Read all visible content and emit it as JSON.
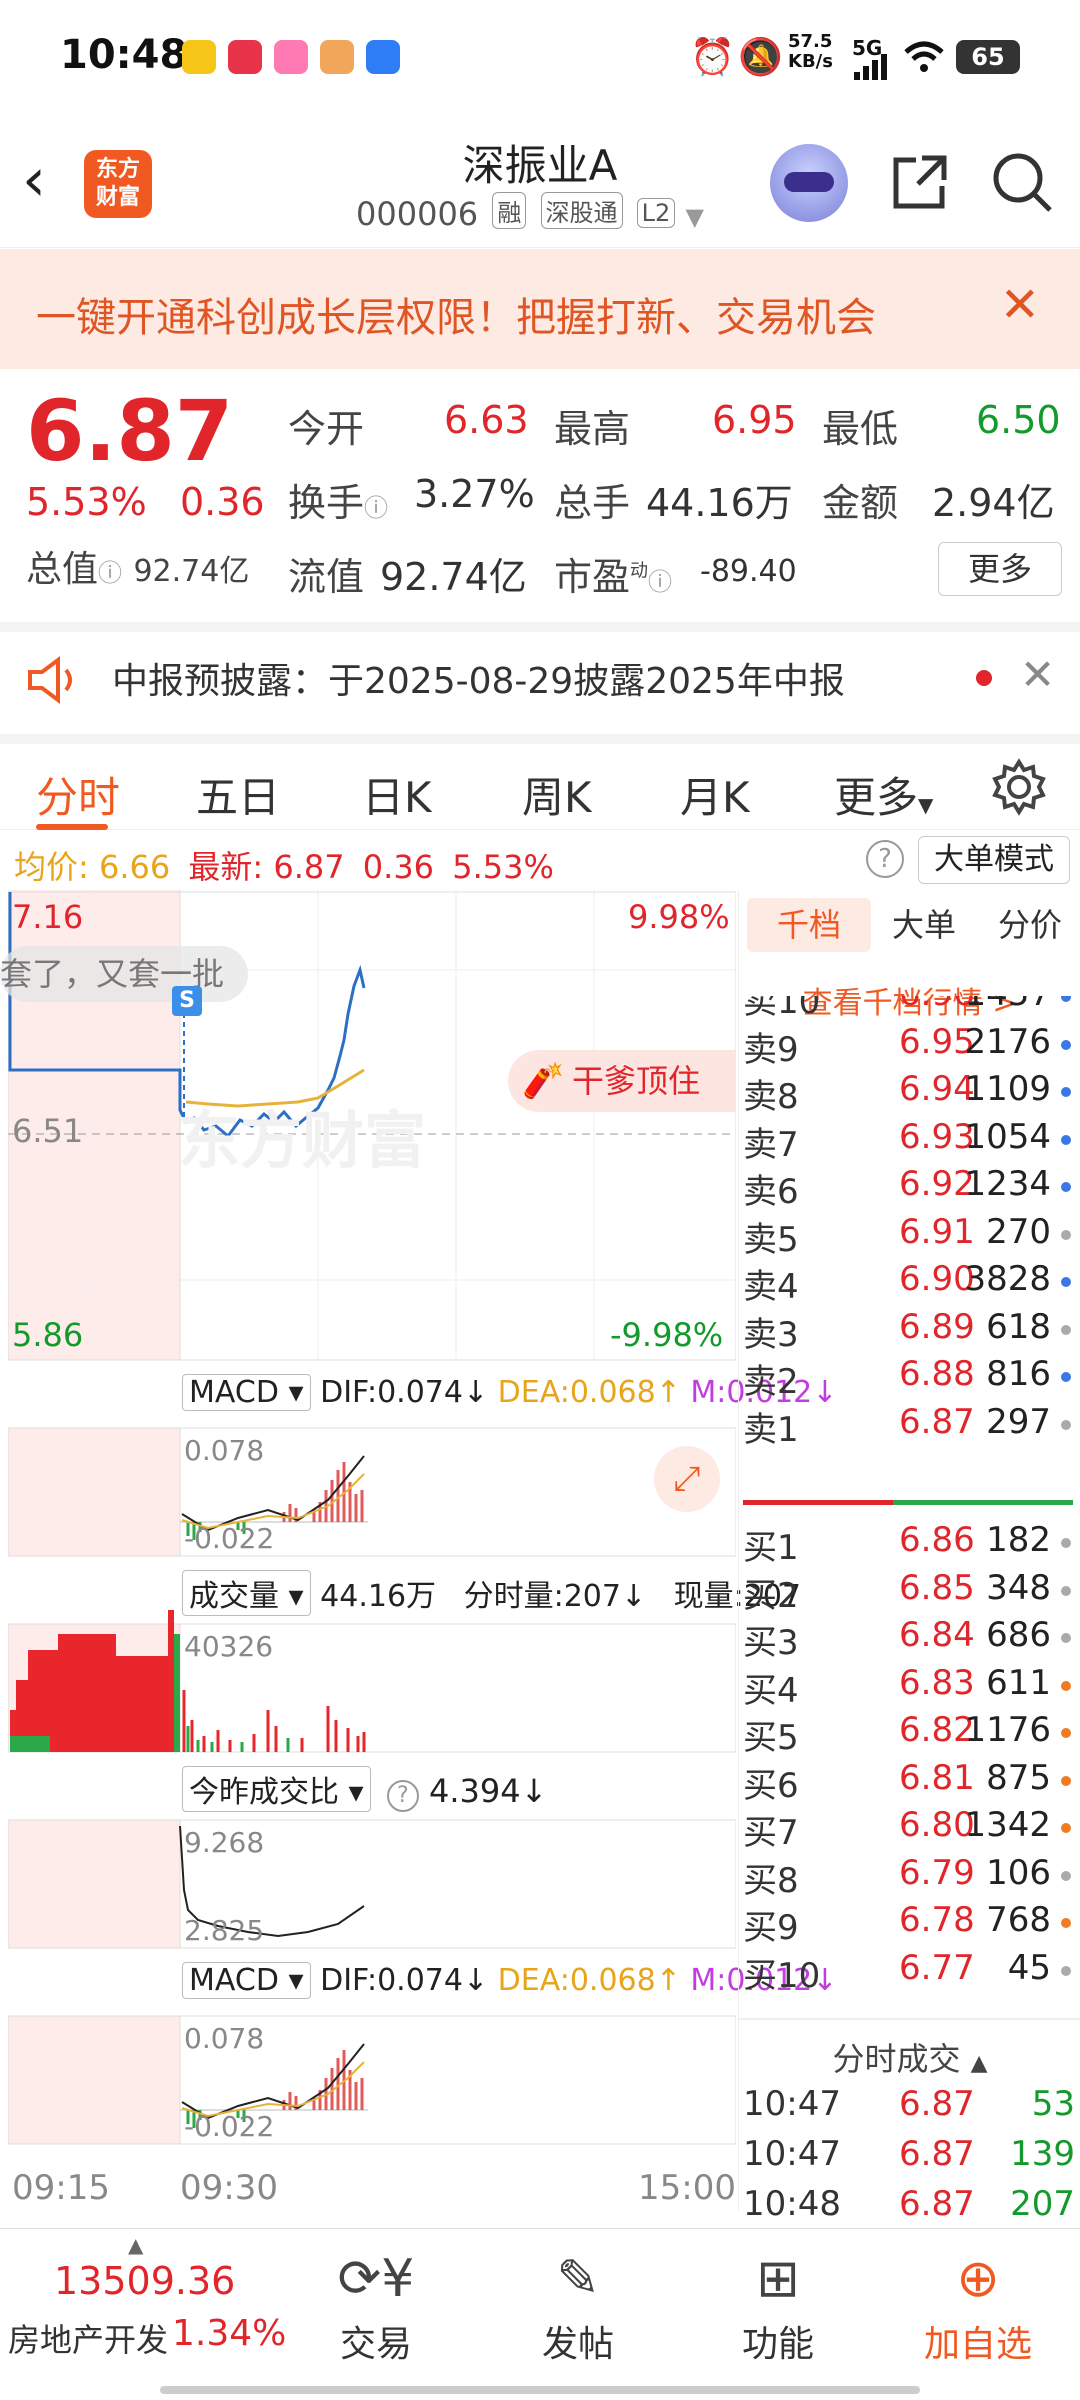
{
  "status": {
    "time": "10:48",
    "net_speed": "57.5",
    "net_unit": "KB/s",
    "network": "5G",
    "battery": "65"
  },
  "header": {
    "title": "深振业A",
    "code": "000006",
    "tags": [
      "融",
      "深股通",
      "L2"
    ]
  },
  "banner": {
    "text": "一键开通科创成长层权限！把握打新、交易机会",
    "close": "✕"
  },
  "quote": {
    "price": "6.87",
    "change_pct": "5.53%",
    "change": "0.36",
    "total_value_label": "总值",
    "total_value": "92.74亿",
    "open_label": "今开",
    "open": "6.63",
    "high_label": "最高",
    "high": "6.95",
    "low_label": "最低",
    "low": "6.50",
    "turnover_label": "换手",
    "turnover": "3.27%",
    "volume_label": "总手",
    "volume": "44.16万",
    "amount_label": "金额",
    "amount": "2.94亿",
    "float_label": "流值",
    "float_value": "92.74亿",
    "pe_label": "市盈",
    "pe_sup": "动",
    "pe": "-89.40",
    "more": "更多"
  },
  "notice": {
    "text": "中报预披露：于2025-08-29披露2025年中报"
  },
  "tabs": [
    "分时",
    "五日",
    "日K",
    "周K",
    "月K",
    "更多"
  ],
  "infoline": {
    "avg_label": "均价:",
    "avg": "6.66",
    "latest_label": "最新:",
    "latest": "6.87",
    "chg": "0.36",
    "pct": "5.53%",
    "big_order_mode": "大单模式"
  },
  "chart": {
    "y_top": "7.16",
    "y_mid": "6.51",
    "y_bottom": "5.86",
    "pct_top": "9.98%",
    "pct_bottom": "-9.98%",
    "danmu": "套了，又套一批",
    "s_marker": "S",
    "promo": "干爹顶住",
    "watermark": "东方财富",
    "macd1": {
      "name": "MACD",
      "dif": "DIF:0.074↓",
      "dea": "DEA:0.068↑",
      "m": "M:0.012↓",
      "top": "0.078",
      "bottom": "-0.022"
    },
    "vol": {
      "name": "成交量",
      "total": "44.16万",
      "tick_label": "分时量:207↓",
      "now": "现量:207",
      "top": "40326"
    },
    "ratio": {
      "name": "今昨成交比",
      "value": "4.394↓",
      "top": "9.268",
      "bottom": "2.825"
    },
    "macd2": {
      "name": "MACD",
      "dif": "DIF:0.074↓",
      "dea": "DEA:0.068↑",
      "m": "M:0.012↓",
      "top": "0.078",
      "bottom": "-0.022"
    },
    "x_labels": [
      "09:15",
      "09:30",
      "15:00"
    ]
  },
  "book": {
    "tabs": [
      "千档",
      "大单",
      "分价"
    ],
    "link": "查看千档行情 >",
    "sells": [
      {
        "name": "卖10",
        "price": "6.96",
        "vol": "1457",
        "dot": "#3b78e7"
      },
      {
        "name": "卖9",
        "price": "6.95",
        "vol": "2176",
        "dot": "#3b78e7"
      },
      {
        "name": "卖8",
        "price": "6.94",
        "vol": "1109",
        "dot": "#3b78e7"
      },
      {
        "name": "卖7",
        "price": "6.93",
        "vol": "1054",
        "dot": "#3b78e7"
      },
      {
        "name": "卖6",
        "price": "6.92",
        "vol": "1234",
        "dot": "#3b78e7"
      },
      {
        "name": "卖5",
        "price": "6.91",
        "vol": "270",
        "dot": "#aaaaaa"
      },
      {
        "name": "卖4",
        "price": "6.90",
        "vol": "3828",
        "dot": "#3b78e7"
      },
      {
        "name": "卖3",
        "price": "6.89",
        "vol": "618",
        "dot": "#aaaaaa"
      },
      {
        "name": "卖2",
        "price": "6.88",
        "vol": "816",
        "dot": "#3b78e7"
      },
      {
        "name": "卖1",
        "price": "6.87",
        "vol": "297",
        "dot": "#aaaaaa"
      }
    ],
    "buys": [
      {
        "name": "买1",
        "price": "6.86",
        "vol": "182",
        "dot": "#aaaaaa"
      },
      {
        "name": "买2",
        "price": "6.85",
        "vol": "348",
        "dot": "#aaaaaa"
      },
      {
        "name": "买3",
        "price": "6.84",
        "vol": "686",
        "dot": "#aaaaaa"
      },
      {
        "name": "买4",
        "price": "6.83",
        "vol": "611",
        "dot": "#f07b22"
      },
      {
        "name": "买5",
        "price": "6.82",
        "vol": "1176",
        "dot": "#f07b22"
      },
      {
        "name": "买6",
        "price": "6.81",
        "vol": "875",
        "dot": "#f07b22"
      },
      {
        "name": "买7",
        "price": "6.80",
        "vol": "1342",
        "dot": "#f07b22"
      },
      {
        "name": "买8",
        "price": "6.79",
        "vol": "106",
        "dot": "#aaaaaa"
      },
      {
        "name": "买9",
        "price": "6.78",
        "vol": "768",
        "dot": "#f07b22"
      },
      {
        "name": "买10",
        "price": "6.77",
        "vol": "45",
        "dot": "#aaaaaa"
      }
    ],
    "trades_title": "分时成交",
    "trades": [
      {
        "time": "10:47",
        "price": "6.87",
        "vol": "53"
      },
      {
        "time": "10:47",
        "price": "6.87",
        "vol": "139"
      },
      {
        "time": "10:48",
        "price": "6.87",
        "vol": "207"
      }
    ]
  },
  "bottom": {
    "index_value": "13509.36",
    "index_name": "房地产开发",
    "index_pct": "1.34%",
    "nav": [
      "交易",
      "发帖",
      "功能",
      "加自选"
    ]
  }
}
